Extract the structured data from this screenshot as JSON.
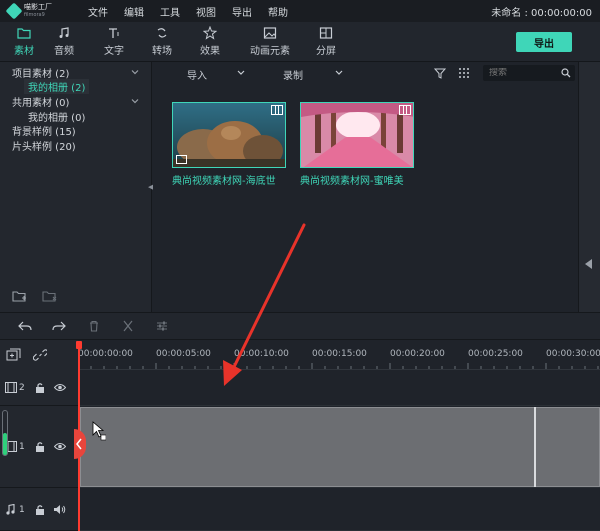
{
  "app": {
    "logo_line1": "喵影工厂",
    "logo_line2": "filmora9",
    "menu": [
      "文件",
      "编辑",
      "工具",
      "视图",
      "导出",
      "帮助"
    ],
    "project_status": "未命名 : 00:00:00:00"
  },
  "tabs": [
    {
      "label": "素材",
      "icon": "folder-icon",
      "active": true
    },
    {
      "label": "音频",
      "icon": "music-note-icon"
    },
    {
      "label": "文字",
      "icon": "text-icon"
    },
    {
      "label": "转场",
      "icon": "transition-icon"
    },
    {
      "label": "效果",
      "icon": "effects-icon"
    },
    {
      "label": "动画元素",
      "icon": "image-icon"
    },
    {
      "label": "分屏",
      "icon": "split-screen-icon"
    }
  ],
  "export_label": "导出",
  "library": {
    "items": [
      {
        "label": "项目素材 (2)"
      },
      {
        "label": "我的相册 (2)"
      },
      {
        "label": "共用素材 (0)"
      },
      {
        "label": "我的相册 (0)"
      },
      {
        "label": "背景样例 (15)"
      },
      {
        "label": "片头样例 (20)"
      }
    ]
  },
  "media_bar": {
    "import_label": "导入",
    "record_label": "录制",
    "search_placeholder": "搜索"
  },
  "media": [
    {
      "caption": "典尚视频素材网-海底世"
    },
    {
      "caption": "典尚视频素材网-蜜唯美"
    }
  ],
  "timeline": {
    "ruler": [
      "00:00:00:00",
      "00:00:05:00",
      "00:00:10:00",
      "00:00:15:00",
      "00:00:20:00",
      "00:00:25:00",
      "00:00:30:00"
    ],
    "tracks": [
      {
        "number": "2",
        "kind": "video"
      },
      {
        "number": "1",
        "kind": "video"
      },
      {
        "number": "1",
        "kind": "audio"
      }
    ]
  },
  "colors": {
    "accent": "#3fd6b8",
    "playhead": "#ff3b30",
    "background": "#1f232a"
  }
}
